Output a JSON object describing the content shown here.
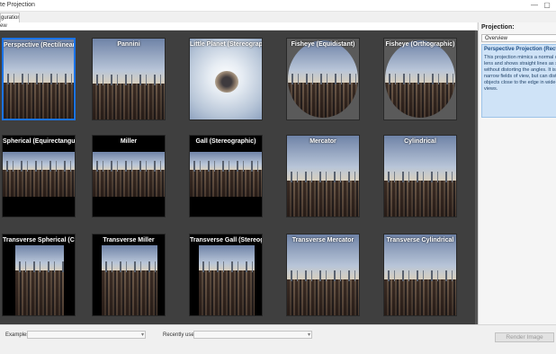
{
  "window": {
    "title": "te Projection",
    "minimize_glyph": "—",
    "restore_glyph": "▢"
  },
  "tab": {
    "label": "guration"
  },
  "subbar": {
    "label": "ew"
  },
  "thumbnails": [
    {
      "label": "Perspective (Rectilinear)",
      "style": "full",
      "selected": true
    },
    {
      "label": "Pannini",
      "style": "full"
    },
    {
      "label": "Little Planet (Stereographic)",
      "style": "planet"
    },
    {
      "label": "Fisheye (Equidistant)",
      "style": "circle"
    },
    {
      "label": "Fisheye (Orthographic)",
      "style": "circle"
    },
    {
      "label": "Spherical (Equirectangular)",
      "style": "band"
    },
    {
      "label": "Miller",
      "style": "band"
    },
    {
      "label": "Gall (Stereographic)",
      "style": "band"
    },
    {
      "label": "Mercator",
      "style": "full"
    },
    {
      "label": "Cylindrical",
      "style": "full"
    },
    {
      "label": "Transverse Spherical (Cassini)",
      "style": "tall"
    },
    {
      "label": "Transverse Miller",
      "style": "tallwide"
    },
    {
      "label": "Transverse Gall (Stereographic)",
      "style": "tallwide"
    },
    {
      "label": "Transverse Mercator",
      "style": "full"
    },
    {
      "label": "Transverse Cylindrical",
      "style": "full"
    }
  ],
  "sidebar": {
    "title": "Projection:",
    "dropdown_value": "Overview",
    "info_heading": "Perspective Projection (Rectilinear)",
    "info_lines": [
      "This projection mimics a normal camera",
      "lens and shows straight lines as straight",
      "without distorting the angles. It is ideal for",
      "narrow fields of view, but can distort",
      "objects close to the edge in wide-angle",
      "views."
    ]
  },
  "bottom": {
    "examples_label": "Examples:",
    "examples_value": "",
    "recent_label": "Recently used:",
    "recent_value": "",
    "render_button": "Render Image"
  },
  "colors": {
    "grid_background": "#3f3f3f",
    "selection": "#1a73e8",
    "info_background": "#cfe3f7"
  }
}
